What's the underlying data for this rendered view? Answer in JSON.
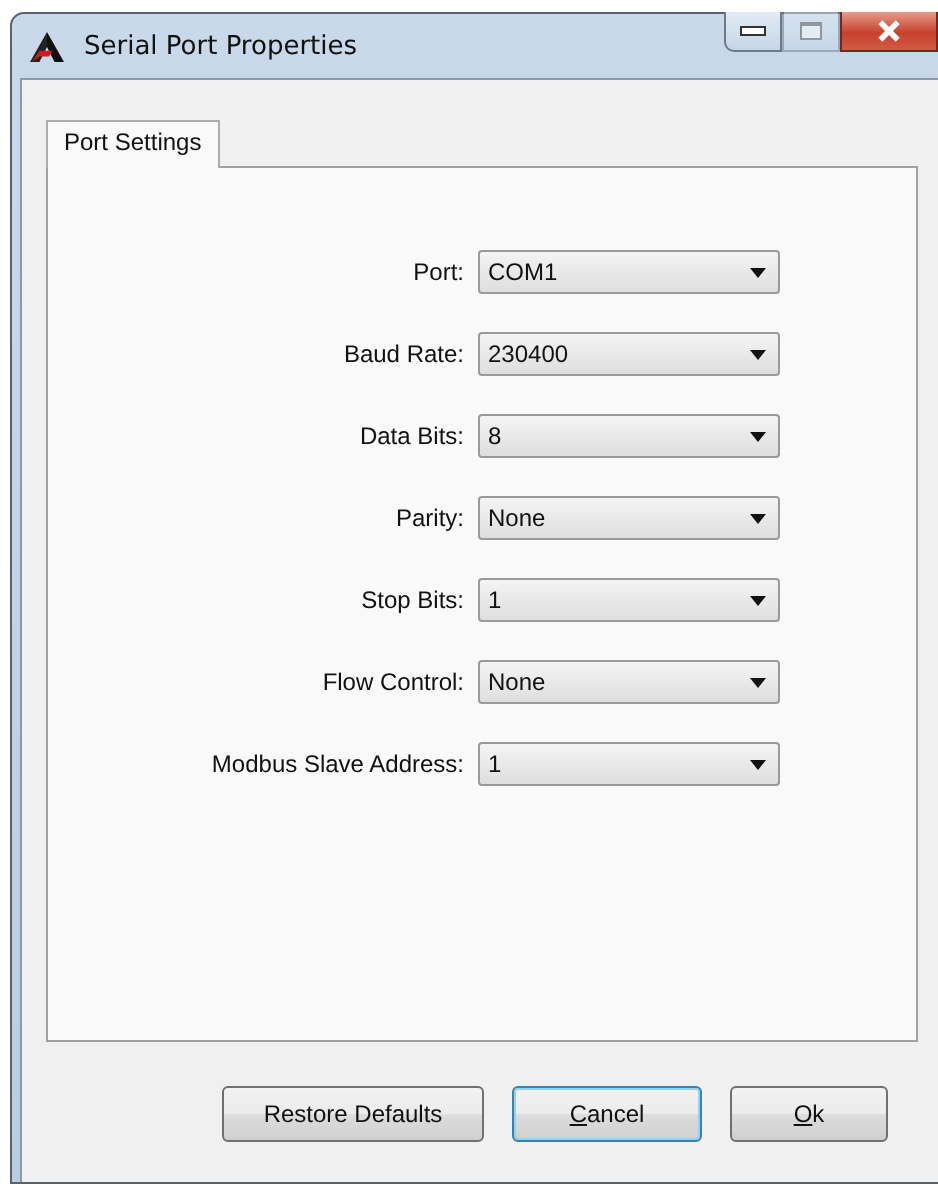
{
  "window": {
    "title": "Serial Port Properties",
    "buttons": [
      {
        "kind": "minimize",
        "disabled": false
      },
      {
        "kind": "maximize",
        "disabled": true
      },
      {
        "kind": "close",
        "disabled": false
      }
    ]
  },
  "tabs": [
    {
      "label": "Port Settings",
      "selected": true
    }
  ],
  "fields": [
    {
      "label": "Port:",
      "value": "COM1"
    },
    {
      "label": "Baud Rate:",
      "value": "230400"
    },
    {
      "label": "Data Bits:",
      "value": "8"
    },
    {
      "label": "Parity:",
      "value": "None"
    },
    {
      "label": "Stop Bits:",
      "value": "1"
    },
    {
      "label": "Flow Control:",
      "value": "None"
    },
    {
      "label": "Modbus Slave Address:",
      "value": "1"
    }
  ],
  "buttons": [
    {
      "kind": "restore",
      "rest": "Restore Defaults",
      "focused": false
    },
    {
      "kind": "cancel",
      "access_key": "C",
      "rest": "ancel",
      "focused": true
    },
    {
      "kind": "ok",
      "access_key": "O",
      "rest": "k",
      "focused": false
    }
  ]
}
